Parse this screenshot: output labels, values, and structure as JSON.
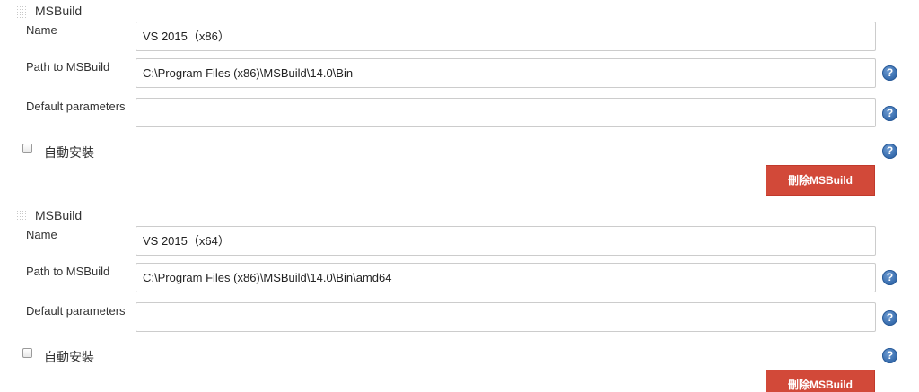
{
  "installations": [
    {
      "section_title": "MSBuild",
      "name_label": "Name",
      "name_value": "VS 2015（x86）",
      "path_label": "Path to MSBuild",
      "path_value": "C:\\Program Files (x86)\\MSBuild\\14.0\\Bin",
      "params_label": "Default parameters",
      "params_value": "",
      "auto_install_label": "自動安裝",
      "auto_install_checked": false,
      "delete_label": "刪除MSBuild"
    },
    {
      "section_title": "MSBuild",
      "name_label": "Name",
      "name_value": "VS 2015（x64）",
      "path_label": "Path to MSBuild",
      "path_value": "C:\\Program Files (x86)\\MSBuild\\14.0\\Bin\\amd64",
      "params_label": "Default parameters",
      "params_value": "",
      "auto_install_label": "自動安裝",
      "auto_install_checked": false,
      "delete_label": "刪除MSBuild"
    }
  ],
  "help_icon_glyph": "?",
  "colors": {
    "delete_button": "#d24939",
    "help_icon": "#3a6fb0"
  }
}
